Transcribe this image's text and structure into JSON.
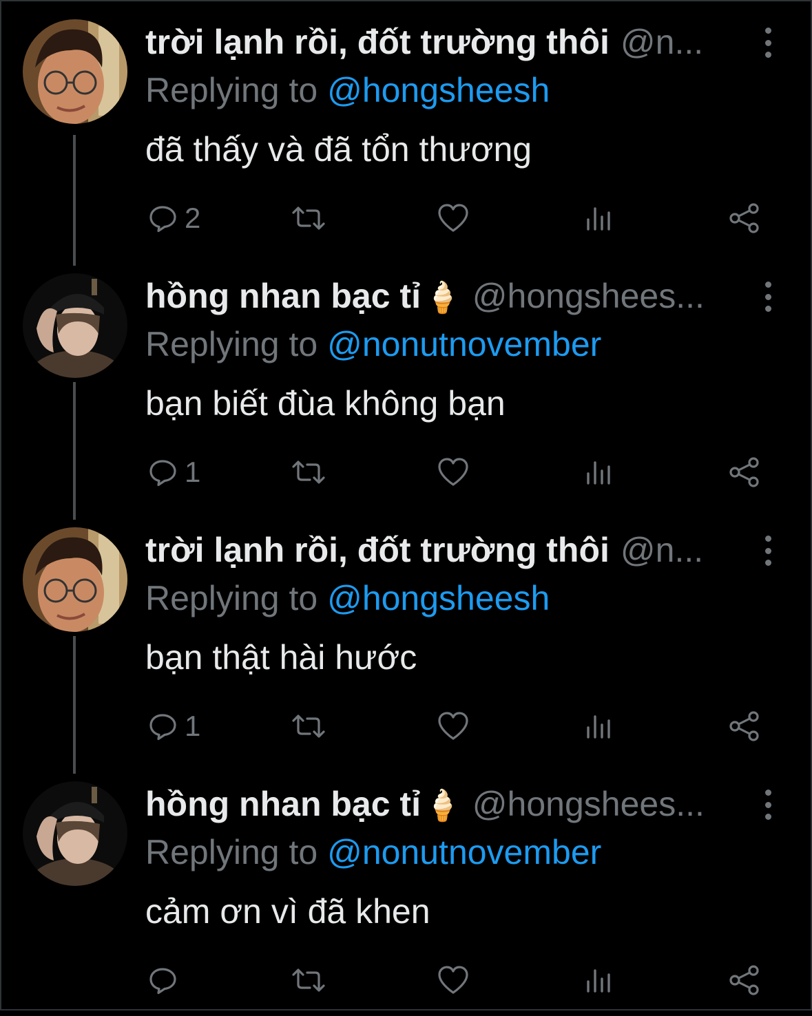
{
  "colors": {
    "background": "#000000",
    "text": "#e7e9ea",
    "muted": "#71767b",
    "link": "#1d9bf0",
    "thread_line": "#4a4d50"
  },
  "reply_prefix": "Replying to",
  "tweets": [
    {
      "display_name": "trời lạnh rồi, đốt trường thôi",
      "emoji": "",
      "handle": "@n...",
      "replying_to": "@hongsheesh",
      "text": "đã thấy và đã tổn thương",
      "reply_count": "2",
      "avatar": "avatar-glasses"
    },
    {
      "display_name": "hồng nhan bạc tỉ",
      "emoji": "🍦",
      "handle": "@hongshees...",
      "replying_to": "@nonutnovember",
      "text": "bạn biết đùa không bạn",
      "reply_count": "1",
      "avatar": "avatar-beanie"
    },
    {
      "display_name": "trời lạnh rồi, đốt trường thôi",
      "emoji": "",
      "handle": "@n...",
      "replying_to": "@hongsheesh",
      "text": "bạn thật hài hước",
      "reply_count": "1",
      "avatar": "avatar-glasses"
    },
    {
      "display_name": "hồng nhan bạc tỉ",
      "emoji": "🍦",
      "handle": "@hongshees...",
      "replying_to": "@nonutnovember",
      "text": "cảm ơn vì đã khen",
      "reply_count": "",
      "avatar": "avatar-beanie"
    }
  ],
  "icons": {
    "reply": "reply-icon",
    "retweet": "retweet-icon",
    "like": "heart-icon",
    "views": "views-icon",
    "share": "share-icon",
    "more": "more-vertical-icon"
  }
}
